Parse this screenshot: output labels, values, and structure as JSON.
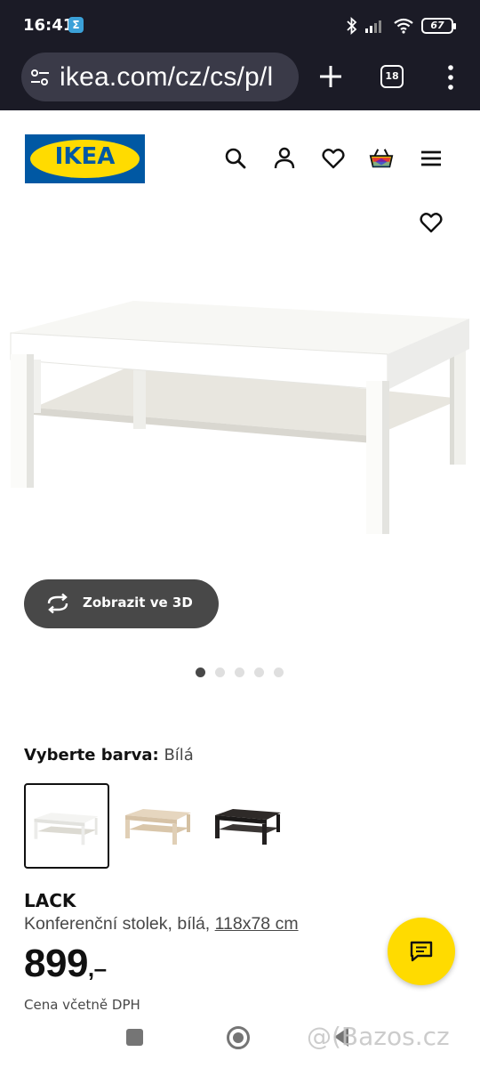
{
  "status_bar": {
    "time": "16:41",
    "app_badge": "Σ",
    "battery": "67"
  },
  "browser": {
    "url": "ikea.com/cz/cs/p/l",
    "tab_count": "18"
  },
  "site": {
    "logo_text": "IKEA",
    "brand_colors": {
      "blue": "#0058a3",
      "yellow": "#ffdb00"
    },
    "header_icons": [
      "search-icon",
      "user-icon",
      "heart-icon",
      "basket-icon",
      "hamburger-menu-icon"
    ]
  },
  "gallery": {
    "view_3d_label": "Zobrazit ve 3D",
    "dots_total": 5,
    "active_dot": 1
  },
  "color_select": {
    "label": "Vyberte barva:",
    "selected": "Bílá",
    "options": [
      "white",
      "white-stained-oak",
      "black-brown"
    ]
  },
  "product": {
    "name": "LACK",
    "description": "Konferenční stolek, bílá, ",
    "size": "118x78 cm",
    "price": "899",
    "price_suffix": ",–",
    "price_note": "Cena včetně DPH"
  },
  "watermark": "@(Bazos.cz"
}
